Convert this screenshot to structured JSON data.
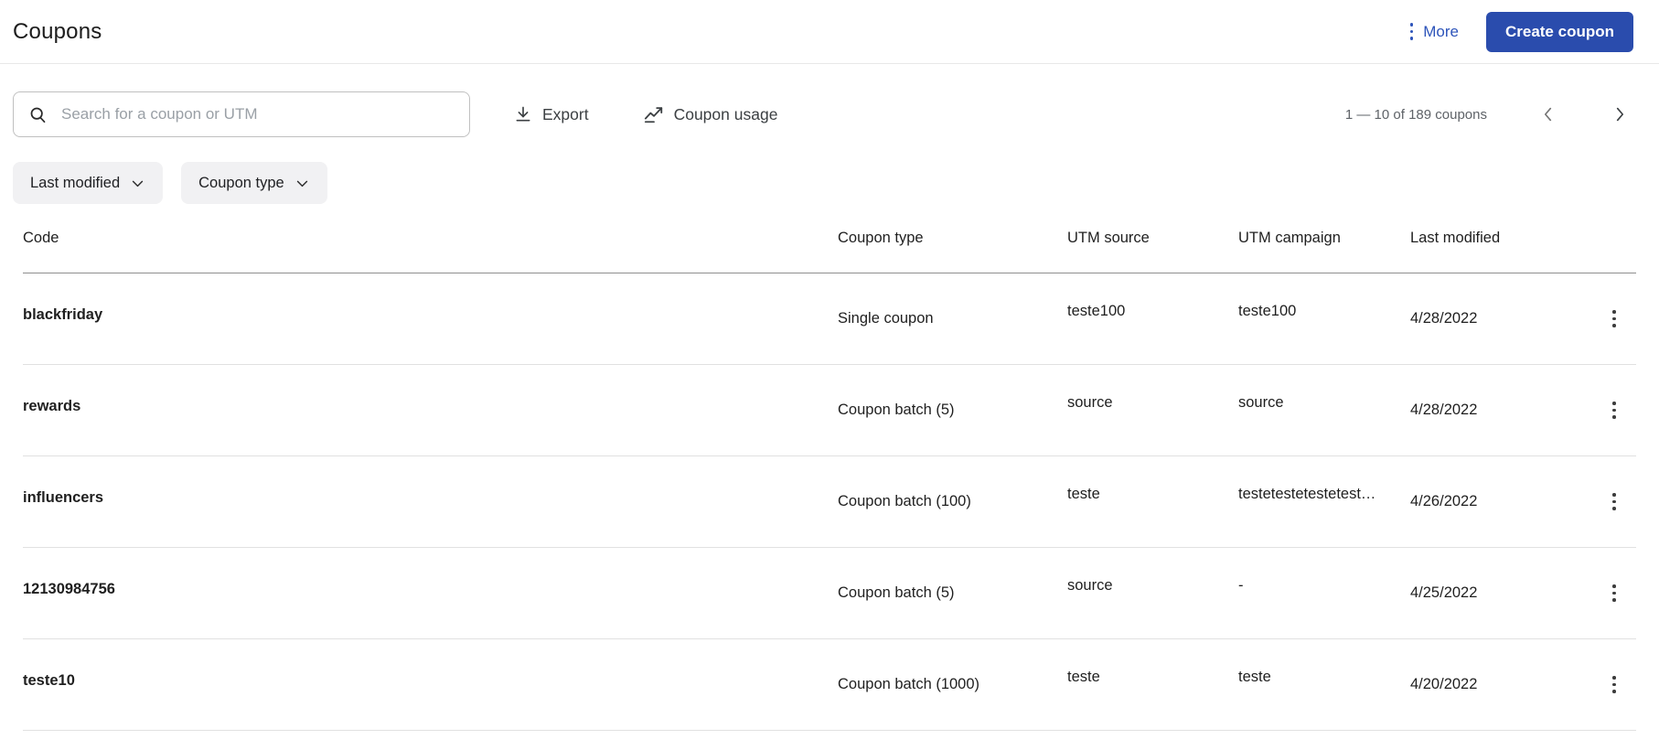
{
  "header": {
    "title": "Coupons",
    "more_label": "More",
    "create_button_label": "Create coupon"
  },
  "toolbar": {
    "search_placeholder": "Search for a coupon or UTM",
    "search_value": "",
    "export_label": "Export",
    "coupon_usage_label": "Coupon usage",
    "pagination_text": "1 — 10 of 189 coupons"
  },
  "filters": [
    {
      "label": "Last modified"
    },
    {
      "label": "Coupon type"
    }
  ],
  "table": {
    "columns": [
      "Code",
      "Coupon type",
      "UTM source",
      "UTM campaign",
      "Last modified"
    ],
    "rows": [
      {
        "code": "blackfriday",
        "coupon_type": "Single coupon",
        "utm_source": "teste100",
        "utm_campaign": "teste100",
        "last_modified": "4/28/2022"
      },
      {
        "code": "rewards",
        "coupon_type": "Coupon batch (5)",
        "utm_source": "source",
        "utm_campaign": "source",
        "last_modified": "4/28/2022"
      },
      {
        "code": "influencers",
        "coupon_type": "Coupon batch (100)",
        "utm_source": "teste",
        "utm_campaign": "testetestetestetest…",
        "last_modified": "4/26/2022"
      },
      {
        "code": "12130984756",
        "coupon_type": "Coupon batch (5)",
        "utm_source": "source",
        "utm_campaign": "-",
        "last_modified": "4/25/2022"
      },
      {
        "code": "teste10",
        "coupon_type": "Coupon batch (1000)",
        "utm_source": "teste",
        "utm_campaign": "teste",
        "last_modified": "4/20/2022"
      }
    ]
  },
  "icons": {
    "search": "magnifier",
    "export": "download-arrow",
    "coupon_usage": "trend-line",
    "more": "kebab-dots",
    "filter_chevron": "chevron-down",
    "prev_page": "chevron-left",
    "next_page": "chevron-right",
    "row_menu": "kebab-dots"
  },
  "colors": {
    "accent": "#2a4cad",
    "link_blue": "#2d54ba",
    "text_primary": "#1f1f1f",
    "text_secondary": "#5f6368",
    "chip_bg": "#f1f1f3",
    "header_divider": "#8f8f8f",
    "row_divider": "#e1e1e1"
  }
}
